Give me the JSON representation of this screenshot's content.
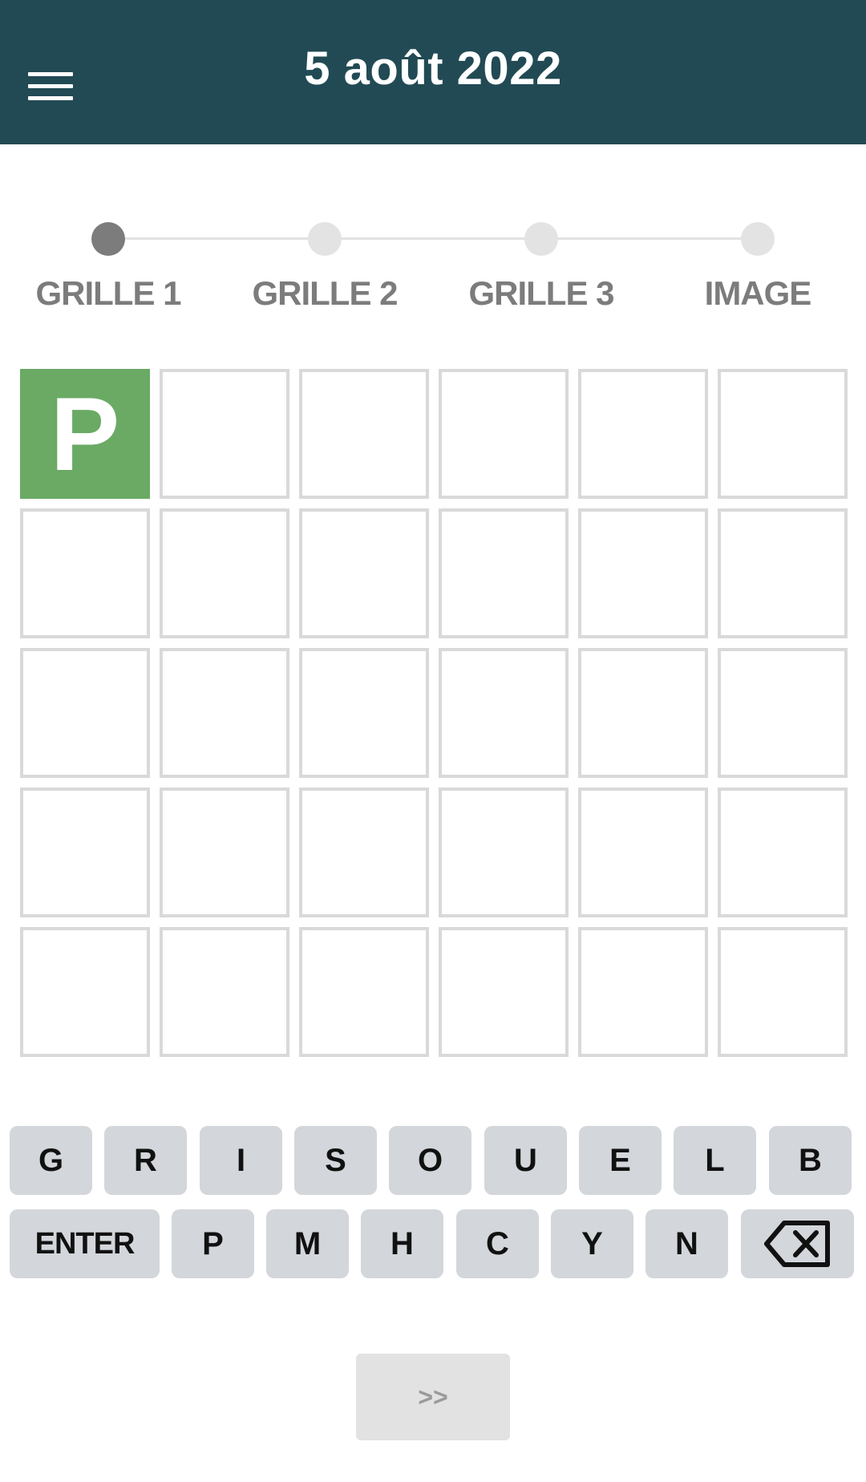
{
  "header": {
    "title": "5 août 2022",
    "menu_icon": "hamburger-menu-icon",
    "background": "#214a54"
  },
  "stepper": {
    "steps": [
      {
        "label": "GRILLE 1",
        "active": true
      },
      {
        "label": "GRILLE 2",
        "active": false
      },
      {
        "label": "GRILLE 3",
        "active": false
      },
      {
        "label": "IMAGE",
        "active": false
      }
    ]
  },
  "grid": {
    "rows": 5,
    "cols": 6,
    "correct_color": "#6aaa64",
    "cells": [
      [
        "P",
        "",
        "",
        "",
        "",
        ""
      ],
      [
        "",
        "",
        "",
        "",
        "",
        ""
      ],
      [
        "",
        "",
        "",
        "",
        "",
        ""
      ],
      [
        "",
        "",
        "",
        "",
        "",
        ""
      ],
      [
        "",
        "",
        "",
        "",
        "",
        ""
      ]
    ],
    "states": [
      [
        "correct",
        "empty",
        "empty",
        "empty",
        "empty",
        "empty"
      ],
      [
        "empty",
        "empty",
        "empty",
        "empty",
        "empty",
        "empty"
      ],
      [
        "empty",
        "empty",
        "empty",
        "empty",
        "empty",
        "empty"
      ],
      [
        "empty",
        "empty",
        "empty",
        "empty",
        "empty",
        "empty"
      ],
      [
        "empty",
        "empty",
        "empty",
        "empty",
        "empty",
        "empty"
      ]
    ]
  },
  "keyboard": {
    "row1": [
      "G",
      "R",
      "I",
      "S",
      "O",
      "U",
      "E",
      "L",
      "B"
    ],
    "row2": [
      "ENTER",
      "P",
      "M",
      "H",
      "C",
      "Y",
      "N"
    ],
    "backspace_icon": "backspace-icon"
  },
  "next_button": {
    "label": ">>"
  }
}
